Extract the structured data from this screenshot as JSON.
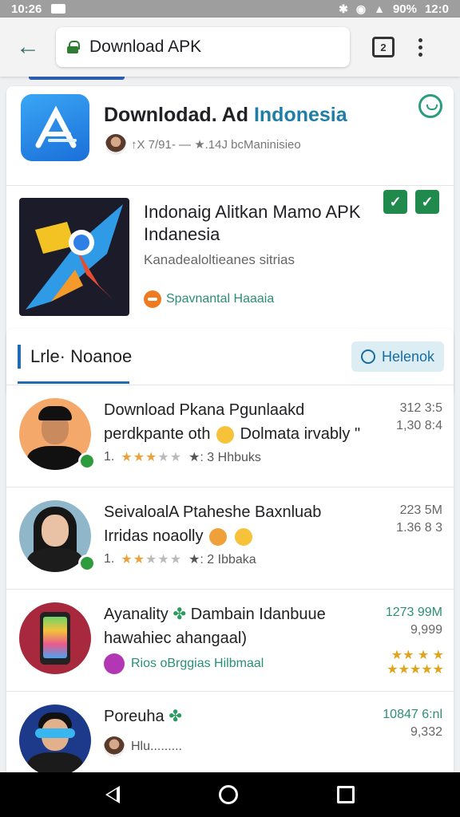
{
  "status_bar": {
    "time": "10:26",
    "battery": "90%",
    "clock_right": "12:0"
  },
  "toolbar": {
    "url": "Download APK",
    "tab_count": "2"
  },
  "featured": {
    "title_main": "Downlodad. Ad",
    "title_accent": "Indonesia",
    "meta": "↑X 7/91‑ — ★.14J bcManinisieo",
    "app2": {
      "title": "Indonaig Alitkan Mamo APK Indanesia",
      "desc": "Kanadealoltieanes sitrias",
      "developer": "Spavnantal Haaaia"
    }
  },
  "section": {
    "title": "Lrle· Noanoe",
    "button": "Helenok"
  },
  "items": [
    {
      "title_a": "Download Pkana Pgunlaakd perdkpante oth",
      "title_b": "Dolmata irvably \"",
      "rating_prefix": "1.",
      "rating_suffix": "★: 3 Hhbuks",
      "size": "312 3:5",
      "count": "1,30 8:4"
    },
    {
      "title_a": "SeivaloalA Ptaheshe Baxnluab Irridas noaolly",
      "rating_prefix": "1.",
      "rating_suffix": "★: 2 Ibbaka",
      "size": "223 5M",
      "count": "1.36 8 3"
    },
    {
      "title_a": "Ayanality",
      "title_b": "Dambain Idanbuue hawahiec ahangaal)",
      "developer": "Rios oBrggias Hilbmaal",
      "size": "1273 99M",
      "count": "9,999"
    },
    {
      "title_a": "Poreuha",
      "sub": "Hlu.........",
      "size": "10847 6:nl",
      "count": "9,332"
    }
  ]
}
